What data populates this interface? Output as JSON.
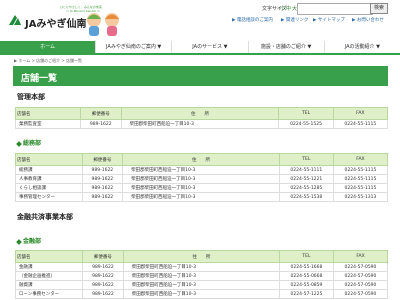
{
  "header": {
    "brand": "JAみやぎ仙南",
    "tagline_1": "ひとにやさしく、みんなの未来",
    "tagline_2": "～ JA Minami Sendai ～",
    "font_size_label": "文字サイズ",
    "font_sizes": [
      "小",
      "中",
      "大"
    ],
    "search_placeholder": "",
    "search_button": "検索",
    "util_links": [
      "▶ 電話相談のご案内",
      "▶ 関連リンク",
      "▶ サイトマップ",
      "▶ お問い合わせ"
    ]
  },
  "nav": {
    "items": [
      "ホーム",
      "JAみやぎ仙南のご案内 ▼",
      "JAのサービス ▼",
      "施設・店舗のご紹介 ▼",
      "JAの活動紹介 ▼"
    ],
    "active_index": 0
  },
  "breadcrumb": "▶ ホーム > 店舗のご紹介 > 店舗一覧",
  "page_title": "店舗一覧",
  "columns": [
    "店舗名",
    "郵便番号",
    "住　　所",
    "TEL",
    "FAX"
  ],
  "sections": [
    {
      "title": "管理本部",
      "groups": [
        {
          "subtitle": "",
          "rows": [
            [
              "業務監査室",
              "989-1622",
              "柴田郡柴田町西船迫一丁目10-3",
              "0224-55-1525",
              "0224-55-1115"
            ]
          ]
        },
        {
          "subtitle": "総務部",
          "rows": [
            [
              "総務課",
              "989-1622",
              "柴田郡柴田町西船迫一丁目10-3",
              "0224-55-1111",
              "0224-55-1115"
            ],
            [
              "人事教育課",
              "989-1622",
              "柴田郡柴田町西船迫一丁目10-3",
              "0224-55-1221",
              "0224-55-1115"
            ],
            [
              "くらし相談課",
              "989-1622",
              "柴田郡柴田町西船迫一丁目10-3",
              "0224-55-1285",
              "0224-55-1115"
            ],
            [
              "事務管理センター",
              "989-1622",
              "柴田郡柴田町西船迫一丁目10-3",
              "0224-55-1538",
              "0224-55-1313"
            ]
          ]
        }
      ]
    },
    {
      "title": "金融共済事業本部",
      "groups": [
        {
          "subtitle": "金融部",
          "rows": [
            [
              "金融課",
              "989-1622",
              "柴田郡柴田町西船迫一丁目10-3",
              "0224-55-1668",
              "0224-57-0590"
            ],
            [
              "（金融企画推進）",
              "989-1622",
              "柴田郡柴田町西船迫一丁目10-3",
              "0224-55-0668",
              "0224-57-0590"
            ],
            [
              "融資課",
              "989-1622",
              "柴田郡柴田町西船迫一丁目10-3",
              "0224-55-0859",
              "0224-57-0590"
            ],
            [
              "ローン事務センター",
              "989-1622",
              "柴田郡柴田町西船迫一丁目10-3",
              "0224-57-1225",
              "0224-57-0590"
            ]
          ]
        }
      ]
    }
  ]
}
